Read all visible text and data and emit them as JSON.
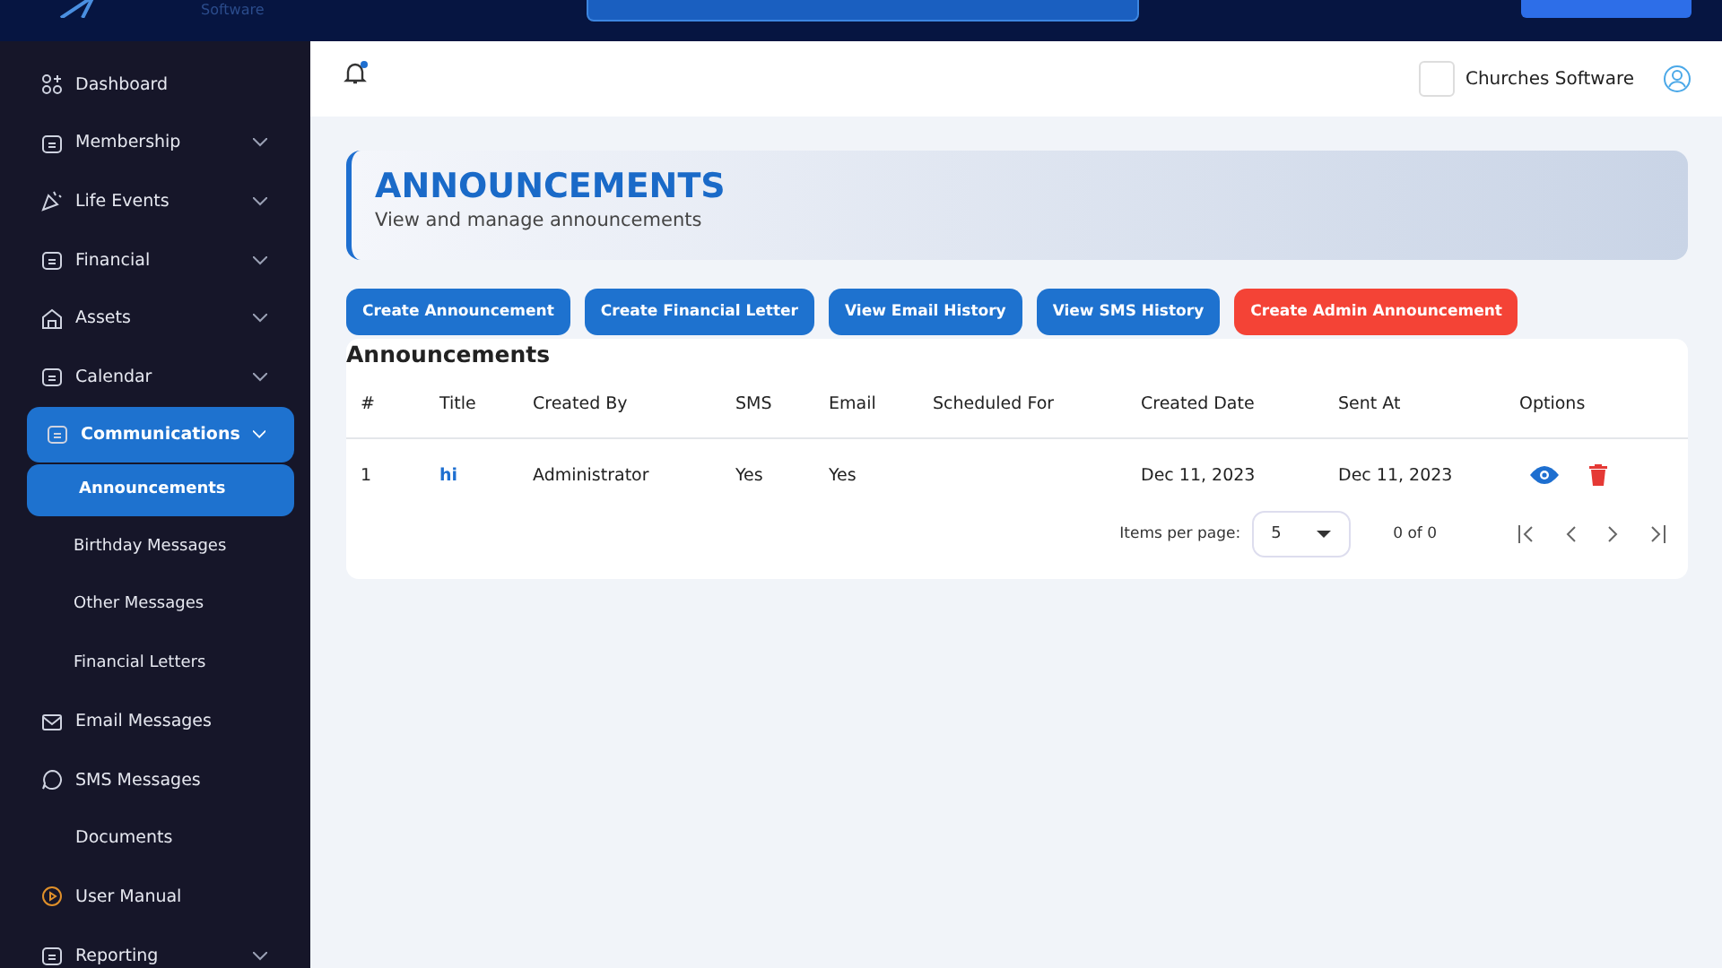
{
  "topbar": {
    "brand": "Software"
  },
  "sidebar": {
    "items": [
      {
        "label": "Dashboard",
        "selected": false
      },
      {
        "label": "Membership",
        "expanded": false,
        "selected": false
      },
      {
        "label": "Life Events",
        "expanded": false,
        "selected": false
      },
      {
        "label": "Financial",
        "expanded": false,
        "selected": false
      },
      {
        "label": "Assets",
        "expanded": false,
        "selected": false
      },
      {
        "label": "Calendar",
        "expanded": false,
        "selected": false
      },
      {
        "label": "Communications",
        "expanded": true,
        "selected": true,
        "children": [
          {
            "label": "Announcements",
            "selected": true
          },
          {
            "label": "Birthday Messages",
            "selected": false
          },
          {
            "label": "Other Messages",
            "selected": false
          },
          {
            "label": "Financial Letters",
            "selected": false
          }
        ]
      },
      {
        "label": "Email Messages",
        "selected": false
      },
      {
        "label": "SMS Messages",
        "selected": false
      },
      {
        "label": "Documents",
        "selected": false
      },
      {
        "label": "User Manual",
        "selected": false
      },
      {
        "label": "Reporting",
        "expanded": false,
        "selected": false
      }
    ]
  },
  "header": {
    "notification_dot": true,
    "org_name": "Churches Software"
  },
  "page": {
    "title": "ANNOUNCEMENTS",
    "subtitle": "View and manage announcements"
  },
  "actions": [
    {
      "label": "Create Announcement",
      "kind": "primary"
    },
    {
      "label": "Create Financial Letter",
      "kind": "primary"
    },
    {
      "label": "View Email History",
      "kind": "primary"
    },
    {
      "label": "View SMS History",
      "kind": "primary"
    },
    {
      "label": "Create Admin Announcement",
      "kind": "danger"
    }
  ],
  "table": {
    "title": "Announcements",
    "columns": [
      "#",
      "Title",
      "Created By",
      "SMS",
      "Email",
      "Scheduled For",
      "Created Date",
      "Sent At",
      "Options"
    ],
    "rows": [
      {
        "cells": [
          "1",
          "hi",
          "Administrator",
          "Yes",
          "Yes",
          "",
          "Dec 11, 2023",
          "Dec 11, 2023"
        ]
      }
    ]
  },
  "pagination": {
    "label": "Items per page:",
    "page_size": "5",
    "range": "0 of 0"
  }
}
